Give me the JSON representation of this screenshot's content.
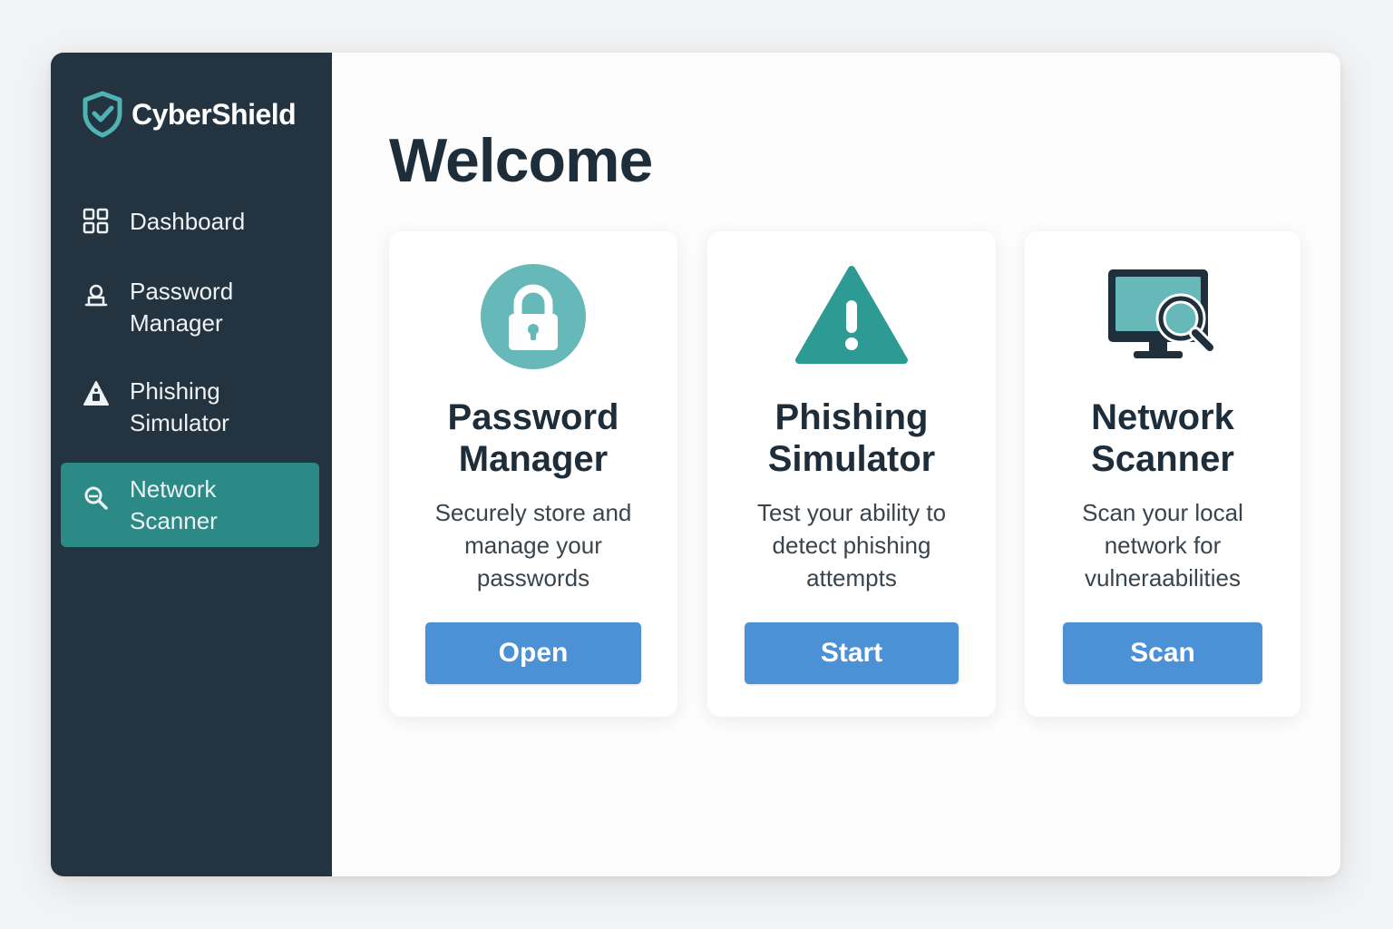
{
  "app": {
    "name": "CyberShield"
  },
  "colors": {
    "sidebar_bg": "#233440",
    "accent_teal": "#2b8a86",
    "button_blue": "#4c90d6",
    "title_dark": "#1e2d3a"
  },
  "sidebar": {
    "items": [
      {
        "label": "Dashboard",
        "icon": "grid-icon",
        "active": false
      },
      {
        "label": "Password Manager",
        "icon": "user-lock-icon",
        "active": false
      },
      {
        "label": "Phishing Simulator",
        "icon": "warning-icon",
        "active": false
      },
      {
        "label": "Network Scanner",
        "icon": "search-icon",
        "active": true
      }
    ]
  },
  "main": {
    "title": "Welcome",
    "cards": [
      {
        "title": "Password Manager",
        "description": "Securely store and manage your passwords",
        "button": "Open",
        "icon": "lock-icon"
      },
      {
        "title": "Phishing Simulator",
        "description": "Test your ability to detect phishing attempts",
        "button": "Start",
        "icon": "warning-icon"
      },
      {
        "title": "Network Scanner",
        "description": "Scan your local network for vulneraabilities",
        "button": "Scan",
        "icon": "monitor-search-icon"
      }
    ]
  }
}
